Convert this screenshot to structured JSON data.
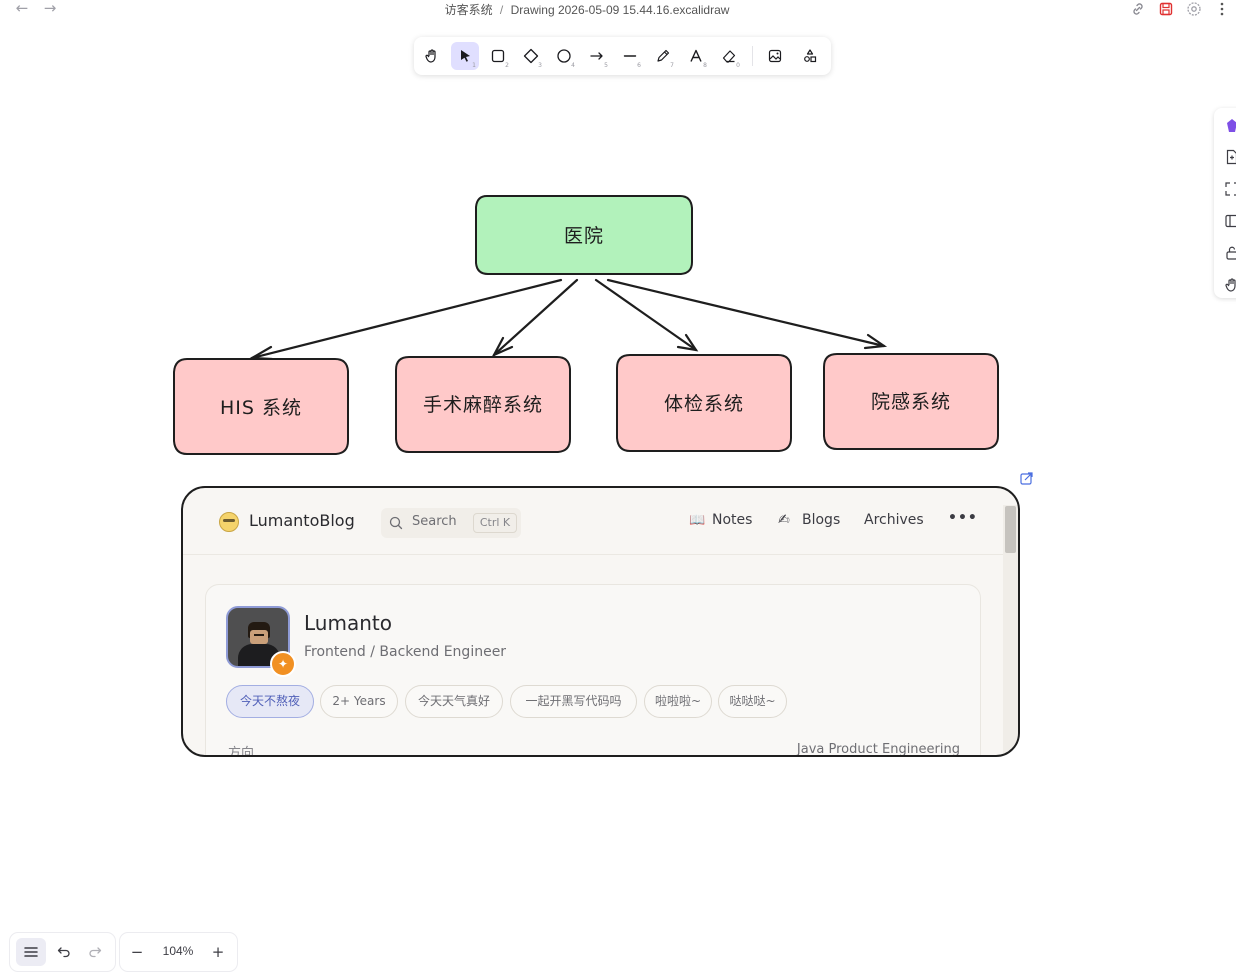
{
  "titlebar": {
    "breadcrumb_folder": "访客系统",
    "separator": "/",
    "file_name": "Drawing 2026-05-09 15.44.16.excalidraw",
    "icons": [
      "back-icon",
      "forward-icon",
      "link-icon",
      "save-icon",
      "settings-icon",
      "more-icon"
    ]
  },
  "toolbar": {
    "tools": [
      {
        "name": "hand",
        "shortcut": ""
      },
      {
        "name": "selection",
        "shortcut": "1",
        "active": true
      },
      {
        "name": "rectangle",
        "shortcut": "2"
      },
      {
        "name": "diamond",
        "shortcut": "3"
      },
      {
        "name": "ellipse",
        "shortcut": "4"
      },
      {
        "name": "arrow",
        "shortcut": "5"
      },
      {
        "name": "line",
        "shortcut": "6"
      },
      {
        "name": "draw",
        "shortcut": "7"
      },
      {
        "name": "text",
        "shortcut": "8"
      },
      {
        "name": "eraser",
        "shortcut": "0"
      },
      {
        "name": "image",
        "shortcut": ""
      },
      {
        "name": "extra-tools",
        "shortcut": ""
      }
    ]
  },
  "diagram": {
    "root": {
      "label": "医院",
      "fill": "#b2f2bb"
    },
    "children": [
      {
        "label": "HIS 系统",
        "fill": "#ffc9c9"
      },
      {
        "label": "手术麻醉系统",
        "fill": "#ffc9c9"
      },
      {
        "label": "体检系统",
        "fill": "#ffc9c9"
      },
      {
        "label": "院感系统",
        "fill": "#ffc9c9"
      }
    ],
    "stroke": "#1e1e1e"
  },
  "embed": {
    "site_name": "LumantoBlog",
    "search_placeholder": "Search",
    "search_shortcut": "Ctrl K",
    "nav": [
      {
        "icon": "book-icon",
        "label": "Notes"
      },
      {
        "icon": "writing-hand-icon",
        "label": "Blogs"
      },
      {
        "icon": "",
        "label": "Archives"
      }
    ],
    "more": "•••",
    "profile": {
      "name": "Lumanto",
      "role": "Frontend / Backend Engineer",
      "badge": "✦"
    },
    "tags": [
      "今天不熬夜",
      "2+ Years",
      "今天天气真好",
      "一起开黑写代码吗",
      "啦啦啦~",
      "哒哒哒~"
    ],
    "footer_left": "方向",
    "footer_right": "Java Product Engineering"
  },
  "zoom": {
    "value": "104%",
    "minus": "−",
    "plus": "+"
  }
}
